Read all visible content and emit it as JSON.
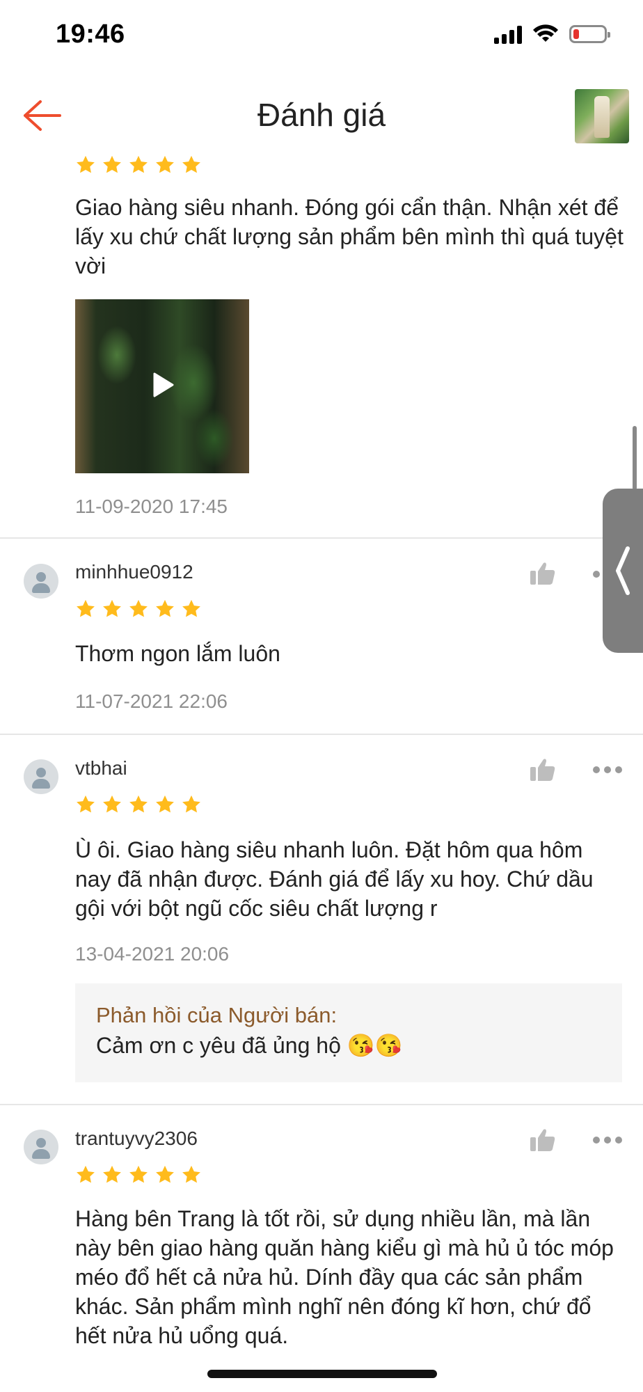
{
  "status_bar": {
    "time": "19:46"
  },
  "nav": {
    "title": "Đánh giá"
  },
  "reviews": [
    {
      "text": "Giao hàng siêu nhanh. Đóng gói cẩn thận. Nhận xét để lấy xu chứ chất lượng sản phẩm bên mình thì quá tuyệt vời",
      "date": "11-09-2020 17:45",
      "rating": 5
    },
    {
      "username": "minhhue0912",
      "rating": 5,
      "text": "Thơm ngon lắm luôn",
      "date": "11-07-2021 22:06"
    },
    {
      "username": "vtbhai",
      "rating": 5,
      "text": "Ù ôi. Giao hàng siêu nhanh luôn. Đặt hôm qua hôm nay đã nhận được. Đánh giá để lấy xu hoy. Chứ dầu gội với bột ngũ cốc siêu chất lượng r",
      "date": "13-04-2021 20:06",
      "seller_reply": {
        "label": "Phản hồi của Người bán:",
        "text": "Cảm ơn c yêu đã ủng hộ 😘😘"
      }
    },
    {
      "username": "trantuyvy2306",
      "rating": 5,
      "text": "Hàng bên Trang là tốt rồi, sử dụng nhiều lần, mà lần này bên giao hàng quăn hàng kiểu gì mà hủ ủ tóc móp méo đổ hết cả nửa hủ. Dính đầy qua các sản phẩm khác. Sản phẩm mình nghĩ nên đóng kĩ hơn, chứ đổ hết nửa hủ uổng quá."
    }
  ],
  "colors": {
    "accent": "#ee4d2d",
    "star": "#ffbb1c",
    "seller_label": "#8b5a2b"
  }
}
